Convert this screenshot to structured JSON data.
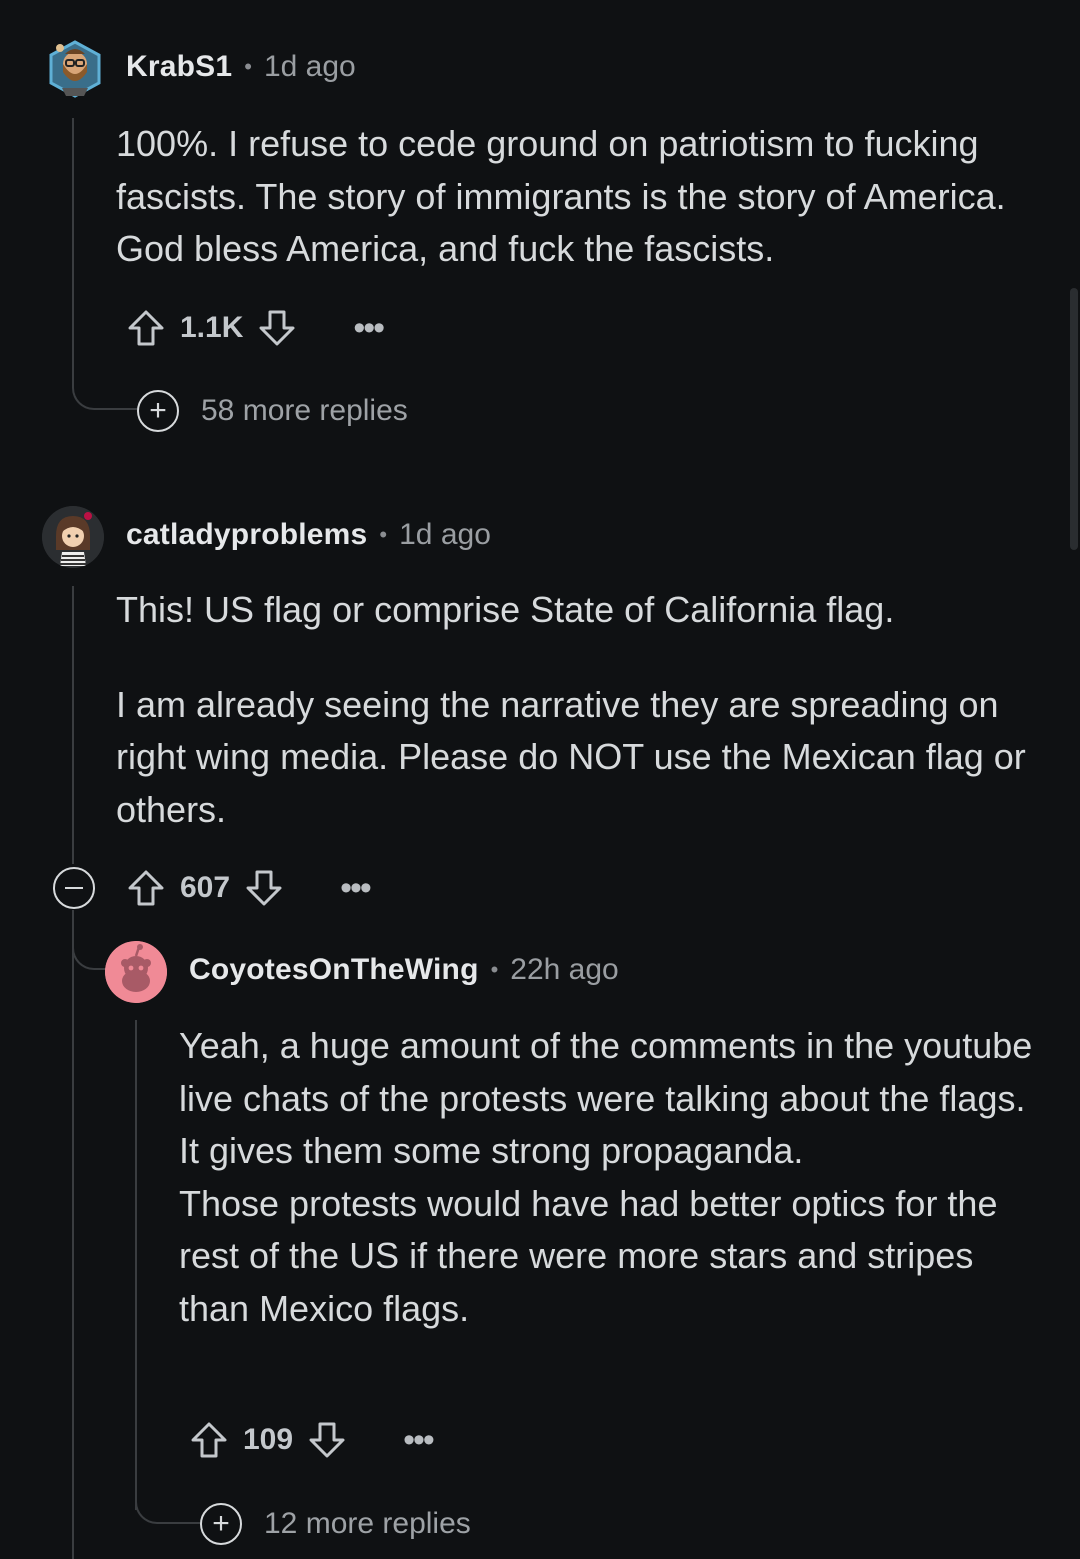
{
  "comments": [
    {
      "username": "KrabS1",
      "time": "1d ago",
      "paragraphs": [
        "100%. I refuse to cede ground on patriotism to fucking fascists. The story of immigrants is the story of America. God bless America, and fuck the fascists."
      ],
      "votes": "1.1K",
      "more_replies": "58 more replies"
    },
    {
      "username": "catladyproblems",
      "time": "1d ago",
      "paragraphs": [
        "This! US flag or comprise State of California flag.",
        "I am already seeing the narrative they are spreading on right wing media. Please do NOT use the Mexican flag or others."
      ],
      "votes": "607"
    },
    {
      "username": "CoyotesOnTheWing",
      "time": "22h ago",
      "paragraphs": [
        "Yeah, a huge amount of the comments in the youtube live chats of the protests were talking about the flags. It gives them some strong propaganda.",
        "Those protests would have had better optics for the rest of the US if there were more stars and stripes than Mexico flags."
      ],
      "votes": "109",
      "more_replies": "12 more replies"
    }
  ],
  "separator": "•",
  "icons": {
    "upvote": "arrow-up-outline",
    "downvote": "arrow-down-outline",
    "more": "ellipsis",
    "expand": "plus-circle",
    "collapse": "minus-circle"
  },
  "colors": {
    "background": "#0f1113",
    "text": "#d7dadc",
    "meta": "#9a9ea2",
    "thread_line": "#3a3d40",
    "snoo_avatar_bg": "#f08a96"
  }
}
